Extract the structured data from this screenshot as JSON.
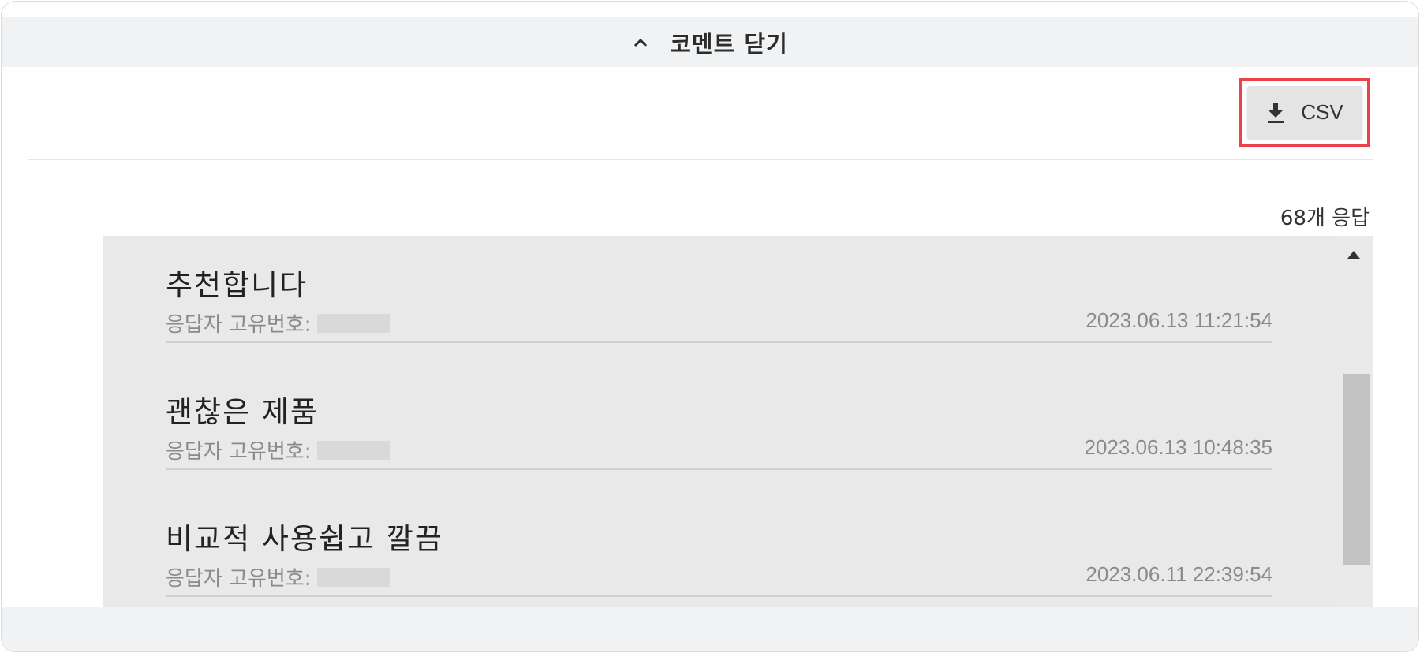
{
  "toggle": {
    "label": "코멘트 닫기",
    "icon": "chevron-up-icon"
  },
  "toolbar": {
    "csv_label": "CSV",
    "csv_icon": "download-icon",
    "highlight_color": "#e8424a"
  },
  "responses": {
    "count_text": "68개 응답"
  },
  "comments": [
    {
      "text": "추천합니다",
      "respondent_label": "응답자 고유번호:",
      "timestamp": "2023.06.13 11:21:54"
    },
    {
      "text": "괜찮은 제품",
      "respondent_label": "응답자 고유번호:",
      "timestamp": "2023.06.13 10:48:35"
    },
    {
      "text": "비교적 사용쉽고 깔끔",
      "respondent_label": "응답자 고유번호:",
      "timestamp": "2023.06.11 22:39:54"
    }
  ],
  "colors": {
    "panel_bg": "#e9e9e9",
    "header_bg": "#f1f2f3",
    "scroll_thumb": "#c2c2c2"
  }
}
